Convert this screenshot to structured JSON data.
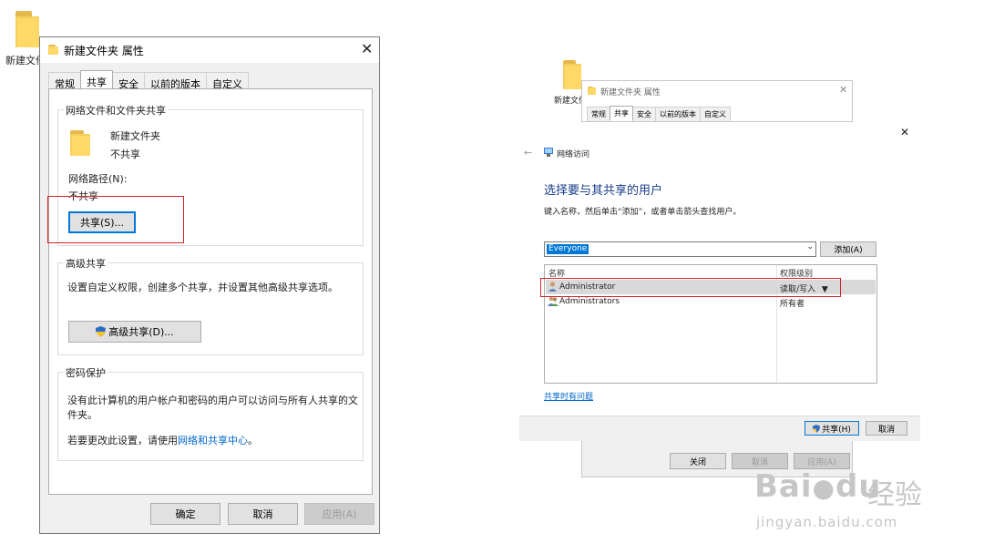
{
  "desktop": {
    "folder_label": "新建文件"
  },
  "props_dialog": {
    "title": "新建文件夹 属性",
    "tabs": [
      {
        "label": "常规"
      },
      {
        "label": "共享"
      },
      {
        "label": "安全"
      },
      {
        "label": "以前的版本"
      },
      {
        "label": "自定义"
      }
    ],
    "network_group": {
      "title": "网络文件和文件夹共享",
      "folder_name": "新建文件夹",
      "folder_status": "不共享",
      "path_label": "网络路径(N):",
      "path_value": "不共享",
      "share_button": "共享(S)..."
    },
    "advanced_group": {
      "title": "高级共享",
      "description": "设置自定义权限，创建多个共享，并设置其他高级共享选项。",
      "button": "高级共享(D)..."
    },
    "password_group": {
      "title": "密码保护",
      "line1": "没有此计算机的用户帐户和密码的用户可以访问与所有人共享的文",
      "line2": "件夹。",
      "change_prefix": "若要更改此设置，请使用",
      "change_link": "网络和共享中心",
      "change_suffix": "。"
    },
    "buttons": {
      "ok": "确定",
      "cancel": "取消",
      "apply": "应用(A)"
    }
  },
  "bg_dialog": {
    "folder_label": "新建文件",
    "title": "新建文件夹 属性",
    "tabs": [
      {
        "label": "常规"
      },
      {
        "label": "共享"
      },
      {
        "label": "安全"
      },
      {
        "label": "以前的版本"
      },
      {
        "label": "自定义"
      }
    ],
    "buttons": {
      "close": "关闭",
      "cancel": "取消",
      "apply": "应用(A)"
    }
  },
  "share_dialog": {
    "breadcrumb": "网络访问",
    "heading": "选择要与其共享的用户",
    "instruction": "键入名称，然后单击“添加”，或者单击箭头查找用户。",
    "combo_value": "Everyone",
    "add_button": "添加(A)",
    "columns": {
      "name": "名称",
      "permission": "权限级别"
    },
    "rows": [
      {
        "name": "Administrator",
        "permission": "读取/写入"
      },
      {
        "name": "Administrators",
        "permission": "所有者"
      }
    ],
    "help_link": "共享时有问题",
    "share_button": "共享(H)",
    "cancel_button": "取消"
  },
  "watermark": {
    "brand_text": "Bai",
    "brand_text2": "du",
    "cn_text": "经验",
    "url": "jingyan.baidu.com"
  }
}
